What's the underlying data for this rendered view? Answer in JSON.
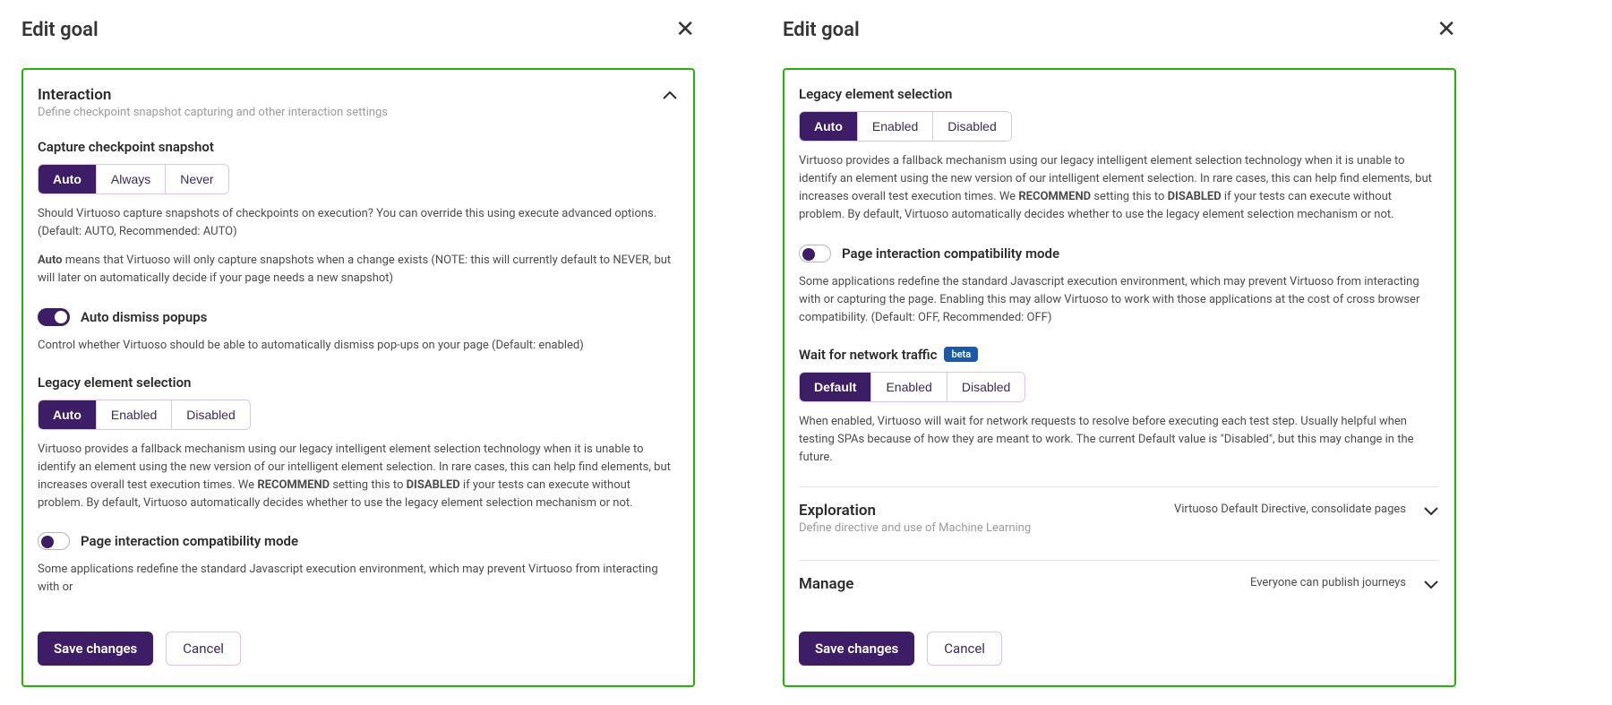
{
  "dialog_title": "Edit goal",
  "interaction": {
    "title": "Interaction",
    "subtitle": "Define checkpoint snapshot capturing and other interaction settings",
    "capture": {
      "title": "Capture checkpoint snapshot",
      "options": [
        "Auto",
        "Always",
        "Never"
      ],
      "selected": "Auto",
      "desc1": "Should Virtuoso capture snapshots of checkpoints on execution? You can override this using execute advanced options. (Default: AUTO, Recommended: AUTO)",
      "desc2_pre": "Auto",
      "desc2_post": " means that Virtuoso will only capture snapshots when a change exists (NOTE: this will currently default to NEVER, but will later on automatically decide if your page needs a new snapshot)"
    },
    "auto_dismiss": {
      "label": "Auto dismiss popups",
      "desc": "Control whether Virtuoso should be able to automatically dismiss pop-ups on your page (Default: enabled)",
      "on": true
    },
    "legacy": {
      "title": "Legacy element selection",
      "options": [
        "Auto",
        "Enabled",
        "Disabled"
      ],
      "selected": "Auto",
      "desc_pre": "Virtuoso provides a fallback mechanism using our legacy intelligent element selection technology when it is unable to identify an element using the new version of our intelligent element selection. In rare cases, this can help find elements, but increases overall test execution times. We ",
      "desc_rec": "RECOMMEND",
      "desc_mid": " setting this to ",
      "desc_dis": "DISABLED",
      "desc_post": " if your tests can execute without problem. By default, Virtuoso automatically decides whether to use the legacy element selection mechanism or not."
    },
    "compat": {
      "label": "Page interaction compatibility mode",
      "desc_partial": "Some applications redefine the standard Javascript execution environment, which may prevent Virtuoso from interacting with or",
      "desc_full": "Some applications redefine the standard Javascript execution environment, which may prevent Virtuoso from interacting with or capturing the page. Enabling this may allow Virtuoso to work with those applications at the cost of cross browser compatibility. (Default: OFF, Recommended: OFF)",
      "on": false
    },
    "wait": {
      "title": "Wait for network traffic",
      "badge": "beta",
      "options": [
        "Default",
        "Enabled",
        "Disabled"
      ],
      "selected": "Default",
      "desc": "When enabled, Virtuoso will wait for network requests to resolve before executing each test step. Usually helpful when testing SPAs because of how they are meant to work. The current Default value is \"Disabled\", but this may change in the future."
    }
  },
  "exploration": {
    "title": "Exploration",
    "subtitle": "Define directive and use of Machine Learning",
    "summary": "Virtuoso Default Directive, consolidate pages"
  },
  "manage": {
    "title": "Manage",
    "summary": "Everyone can publish journeys"
  },
  "buttons": {
    "save": "Save changes",
    "cancel": "Cancel"
  }
}
